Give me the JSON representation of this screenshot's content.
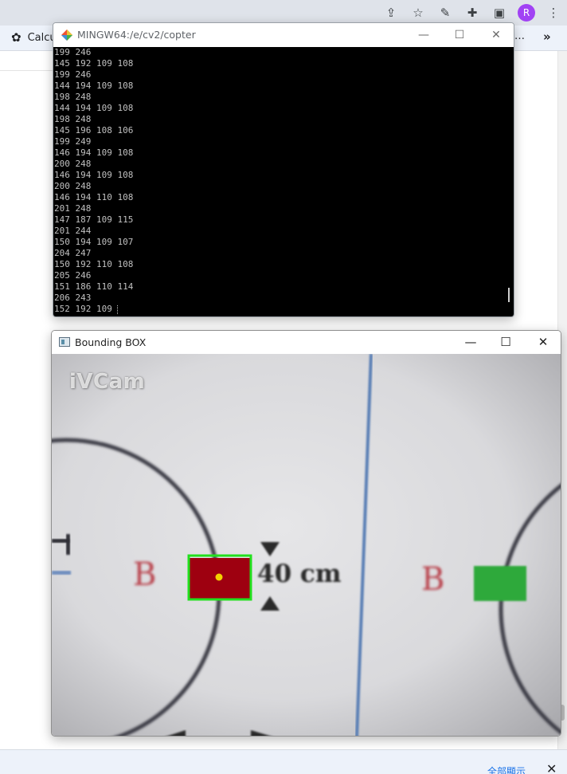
{
  "browser": {
    "bookmark_label": "Calcu",
    "bookmark_overflow": "…",
    "more_bookmarks": "»",
    "avatar_letter": "R",
    "download_bar": {
      "show_all_label": "全部顯示",
      "close_label": "✕"
    }
  },
  "terminal": {
    "title": "MINGW64:/e/cv2/copter",
    "minimize_label": "—",
    "maximize_label": "☐",
    "close_label": "✕",
    "lines": [
      "199 246",
      "145 192 109 108",
      "199 246",
      "144 194 109 108",
      "198 248",
      "144 194 109 108",
      "198 248",
      "145 196 108 106",
      "199 249",
      "146 194 109 108",
      "200 248",
      "146 194 109 108",
      "200 248",
      "146 194 110 108",
      "201 248",
      "147 187 109 115",
      "201 244",
      "150 194 109 107",
      "204 247",
      "150 192 110 108",
      "205 246",
      "151 186 110 114",
      "206 243",
      "152 192 109 "
    ]
  },
  "bounding_box_window": {
    "title": "Bounding BOX",
    "minimize_label": "—",
    "maximize_label": "☐",
    "close_label": "✕",
    "watermark": "iVCam",
    "label_left": "B",
    "label_right": "B",
    "distance_label": "40 cm",
    "colors": {
      "bbox_outline": "#22e01e",
      "target_fill": "#9e0010",
      "centroid": "#f2d200",
      "green_target": "#2fa93a",
      "blue_line": "#5a7fb5",
      "circle_stroke": "#3a3a44"
    }
  }
}
